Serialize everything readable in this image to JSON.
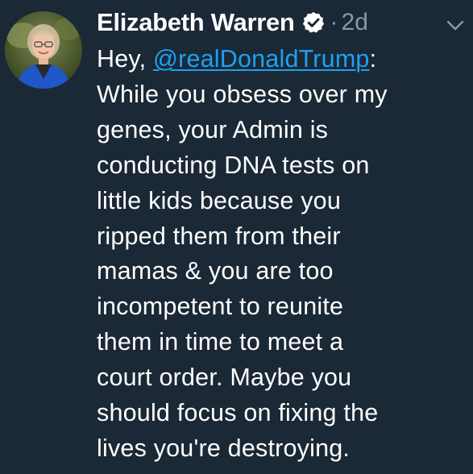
{
  "tweet": {
    "author": {
      "name": "Elizabeth Warren",
      "verified_icon": "verified-badge-icon",
      "avatar_icon": "profile-photo-avatar"
    },
    "separator": "·",
    "time": "2d",
    "menu_icon": "chevron-down-icon",
    "text": {
      "greeting": "Hey, ",
      "mention": "@realDonaldTrump",
      "after_mention": ":",
      "lines": [
        "While you obsess over my",
        "genes, your Admin is",
        "conducting DNA tests on",
        "little kids because you",
        "ripped them from their",
        "mamas & you are too",
        "incompetent to reunite",
        "them in time to meet a",
        "court order. Maybe you",
        "should focus on fixing the",
        "lives you're destroying."
      ]
    }
  },
  "colors": {
    "background": "#1b2836",
    "text": "#ffffff",
    "muted": "#8899a6",
    "link": "#1da1f2"
  }
}
